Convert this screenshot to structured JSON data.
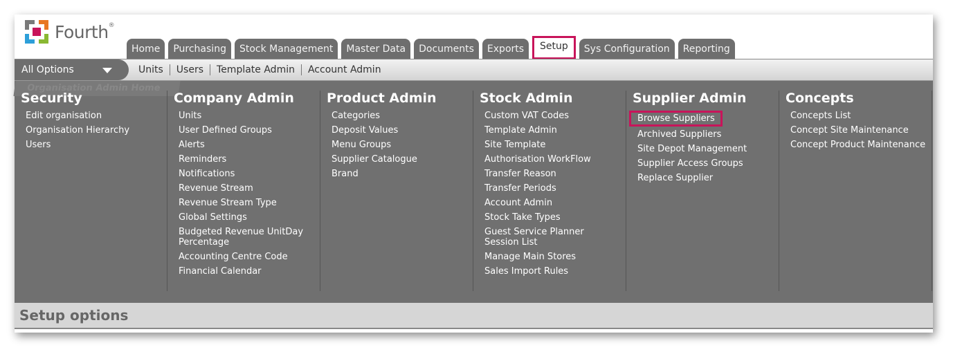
{
  "logo": {
    "text": "Fourth",
    "tm": "®"
  },
  "tabs": [
    {
      "label": "Home"
    },
    {
      "label": "Purchasing"
    },
    {
      "label": "Stock Management"
    },
    {
      "label": "Master Data"
    },
    {
      "label": "Documents"
    },
    {
      "label": "Exports"
    },
    {
      "label": "Setup"
    },
    {
      "label": "Sys Configuration"
    },
    {
      "label": "Reporting"
    }
  ],
  "subbar": {
    "all_options": "All Options",
    "links": [
      "Units",
      "Users",
      "Template Admin",
      "Account Admin"
    ]
  },
  "panel": {
    "org_home": "Organisation Admin Home",
    "columns": [
      {
        "title": "Security",
        "items": [
          "Edit organisation",
          "Organisation Hierarchy",
          "Users"
        ]
      },
      {
        "title": "Company Admin",
        "items": [
          "Units",
          "User Defined Groups",
          "Alerts",
          "Reminders",
          "Notifications",
          "Revenue Stream",
          "Revenue Stream Type",
          "Global Settings",
          "Budgeted Revenue UnitDay Percentage",
          "Accounting Centre Code",
          "Financial Calendar"
        ]
      },
      {
        "title": "Product Admin",
        "items": [
          "Categories",
          "Deposit Values",
          "Menu Groups",
          "Supplier Catalogue",
          "Brand"
        ]
      },
      {
        "title": "Stock Admin",
        "items": [
          "Custom VAT Codes",
          "Template Admin",
          "Site Template",
          "Authorisation WorkFlow",
          "Transfer Reason",
          "Transfer Periods",
          "Account Admin",
          "Stock Take Types",
          "Guest Service Planner Session List",
          "Manage Main Stores",
          "Sales Import Rules"
        ]
      },
      {
        "title": "Supplier Admin",
        "items": [
          "Browse Suppliers",
          "Archived Suppliers",
          "Site Depot Management",
          "Supplier Access Groups",
          "Replace Supplier"
        ]
      },
      {
        "title": "Concepts",
        "items": [
          "Concepts List",
          "Concept Site Maintenance",
          "Concept Product Maintenance"
        ]
      }
    ]
  },
  "footer": {
    "title": "Setup options"
  },
  "colors": {
    "highlight": "#c8145a",
    "menu_bg": "#707070",
    "tab_bg": "#6e6e6e"
  }
}
